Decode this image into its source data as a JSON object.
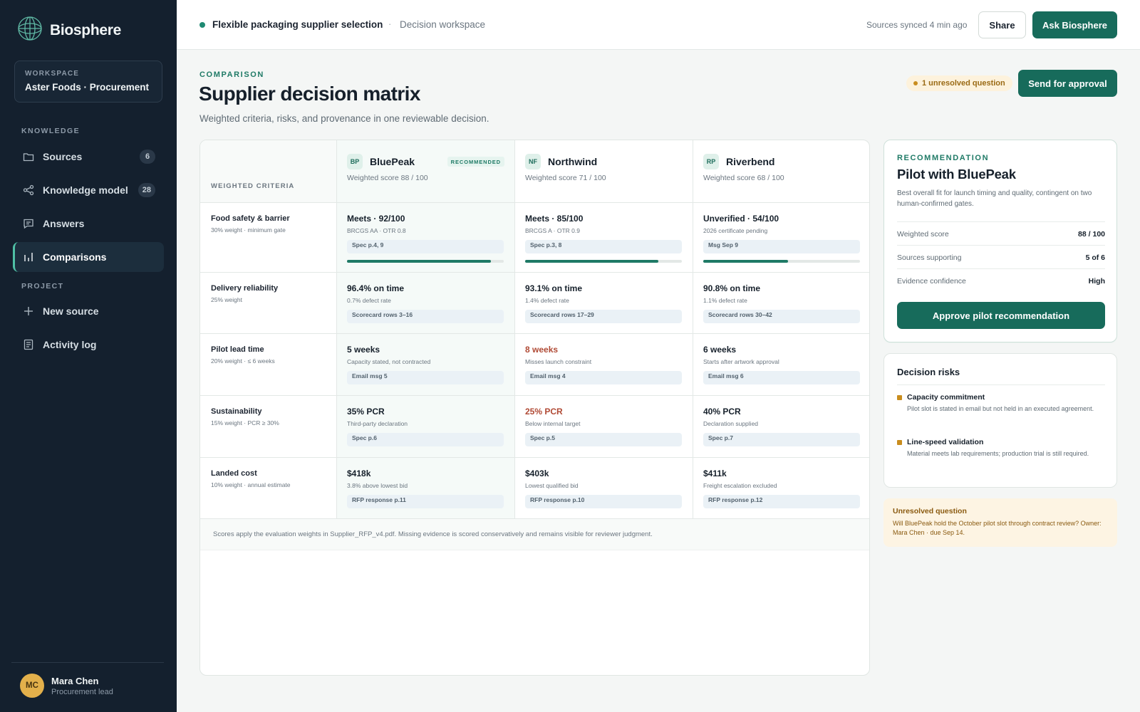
{
  "app": {
    "name": "Biosphere"
  },
  "workspace": {
    "label": "WORKSPACE",
    "name": "Aster Foods · Procurement"
  },
  "sidebar": {
    "knowledge_label": "KNOWLEDGE",
    "project_label": "PROJECT",
    "items": [
      {
        "label": "Sources",
        "count": "6",
        "icon": "folder-icon"
      },
      {
        "label": "Knowledge model",
        "count": "28",
        "icon": "share-nodes-icon"
      },
      {
        "label": "Answers",
        "icon": "chat-icon"
      },
      {
        "label": "Comparisons",
        "icon": "bar-chart-icon",
        "active": true
      }
    ],
    "project_items": [
      {
        "label": "New source",
        "icon": "plus-icon"
      },
      {
        "label": "Activity log",
        "icon": "log-icon"
      }
    ]
  },
  "user": {
    "initials": "MC",
    "name": "Mara Chen",
    "role": "Procurement lead"
  },
  "topbar": {
    "title": "Flexible packaging supplier selection",
    "separator": "·",
    "subtitle": "Decision workspace",
    "sync_status": "Sources synced 4 min ago",
    "share_label": "Share",
    "ask_label": "Ask Biosphere"
  },
  "page": {
    "eyebrow": "COMPARISON",
    "title": "Supplier decision matrix",
    "subtitle": "Weighted criteria, risks, and provenance in one reviewable decision.",
    "unresolved_pill": "1 unresolved question",
    "send_label": "Send for approval"
  },
  "matrix": {
    "criteria_header": "WEIGHTED CRITERIA",
    "suppliers": [
      {
        "code": "BP",
        "name": "BluePeak",
        "score": "Weighted score 88 / 100",
        "tag": "RECOMMENDED"
      },
      {
        "code": "NF",
        "name": "Northwind",
        "score": "Weighted score 71 / 100"
      },
      {
        "code": "RP",
        "name": "Riverbend",
        "score": "Weighted score 68 / 100"
      }
    ],
    "rows": [
      {
        "name": "Food safety & barrier",
        "meta": "30% weight · minimum gate",
        "cells": [
          {
            "value": "Meets · 92/100",
            "note": "BRCGS AA · OTR 0.8",
            "source": "Spec p.4, 9",
            "progress": 0.92
          },
          {
            "value": "Meets · 85/100",
            "note": "BRCGS A · OTR 0.9",
            "source": "Spec p.3, 8",
            "progress": 0.85
          },
          {
            "value": "Unverified · 54/100",
            "note": "2026 certificate pending",
            "source": "Msg Sep 9",
            "progress": 0.54
          }
        ]
      },
      {
        "name": "Delivery reliability",
        "meta": "25% weight",
        "cells": [
          {
            "value": "96.4% on time",
            "note": "0.7% defect rate",
            "source": "Scorecard rows 3–16"
          },
          {
            "value": "93.1% on time",
            "note": "1.4% defect rate",
            "source": "Scorecard rows 17–29"
          },
          {
            "value": "90.8% on time",
            "note": "1.1% defect rate",
            "source": "Scorecard rows 30–42"
          }
        ]
      },
      {
        "name": "Pilot lead time",
        "meta": "20% weight · ≤ 6 weeks",
        "cells": [
          {
            "value": "5 weeks",
            "note": "Capacity stated, not contracted",
            "source": "Email msg 5"
          },
          {
            "value": "8 weeks",
            "note": "Misses launch constraint",
            "source": "Email msg 4",
            "warn": true
          },
          {
            "value": "6 weeks",
            "note": "Starts after artwork approval",
            "source": "Email msg 6"
          }
        ]
      },
      {
        "name": "Sustainability",
        "meta": "15% weight · PCR ≥ 30%",
        "cells": [
          {
            "value": "35% PCR",
            "note": "Third-party declaration",
            "source": "Spec p.6"
          },
          {
            "value": "25% PCR",
            "note": "Below internal target",
            "source": "Spec p.5",
            "warn": true
          },
          {
            "value": "40% PCR",
            "note": "Declaration supplied",
            "source": "Spec p.7"
          }
        ]
      },
      {
        "name": "Landed cost",
        "meta": "10% weight · annual estimate",
        "cells": [
          {
            "value": "$418k",
            "note": "3.8% above lowest bid",
            "source": "RFP response p.11"
          },
          {
            "value": "$403k",
            "note": "Lowest qualified bid",
            "source": "RFP response p.10"
          },
          {
            "value": "$411k",
            "note": "Freight escalation excluded",
            "source": "RFP response p.12"
          }
        ]
      }
    ],
    "footnote": "Scores apply the evaluation weights in Supplier_RFP_v4.pdf. Missing evidence is scored conservatively and remains visible for reviewer judgment."
  },
  "recommendation": {
    "eyebrow": "RECOMMENDATION",
    "title": "Pilot with BluePeak",
    "description": "Best overall fit for launch timing and quality, contingent on two human-confirmed gates.",
    "stats": [
      {
        "label": "Weighted score",
        "value": "88 / 100"
      },
      {
        "label": "Sources supporting",
        "value": "5 of 6"
      },
      {
        "label": "Evidence confidence",
        "value": "High"
      }
    ],
    "approve_label": "Approve pilot recommendation"
  },
  "risks": {
    "title": "Decision risks",
    "items": [
      {
        "name": "Capacity commitment",
        "desc": "Pilot slot is stated in email but not held in an executed agreement."
      },
      {
        "name": "Line-speed validation",
        "desc": "Material meets lab requirements; production trial is still required."
      }
    ]
  },
  "question": {
    "title": "Unresolved question",
    "text": "Will BluePeak hold the October pilot slot through contract review? Owner: Mara Chen · due Sep 14."
  },
  "colors": {
    "accent": "#176b5b",
    "sidebar": "#14202e",
    "warn": "#b04a35",
    "amber": "#c98d1e"
  }
}
